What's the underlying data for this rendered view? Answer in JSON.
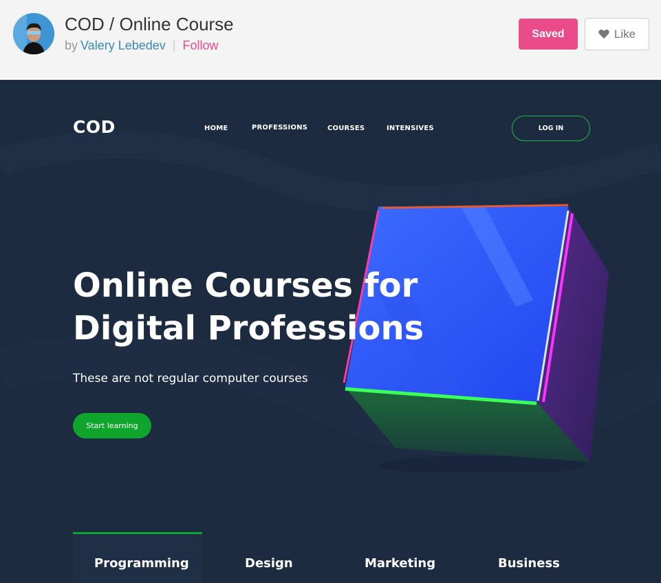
{
  "header": {
    "title": "COD / Online Course",
    "by": "by",
    "author": "Valery Lebedev",
    "separator": "|",
    "follow": "Follow",
    "saved_label": "Saved",
    "like_label": "Like"
  },
  "shot": {
    "logo": "COD",
    "nav": [
      "HOME",
      "PROFESSIONS",
      "COURSES",
      "INTENSIVES"
    ],
    "login_label": "LOG IN",
    "headline_line1": "Online Courses for",
    "headline_line2": "Digital Professions",
    "subline": "These are not regular computer courses",
    "start_label": "Start learning",
    "tabs": [
      "Programming",
      "Design",
      "Marketing",
      "Business"
    ]
  },
  "colors": {
    "brand_pink": "#ea4c89",
    "link_blue": "#3a87b5",
    "canvas_bg": "#1c2b40",
    "accent_green": "#0fa52c"
  }
}
